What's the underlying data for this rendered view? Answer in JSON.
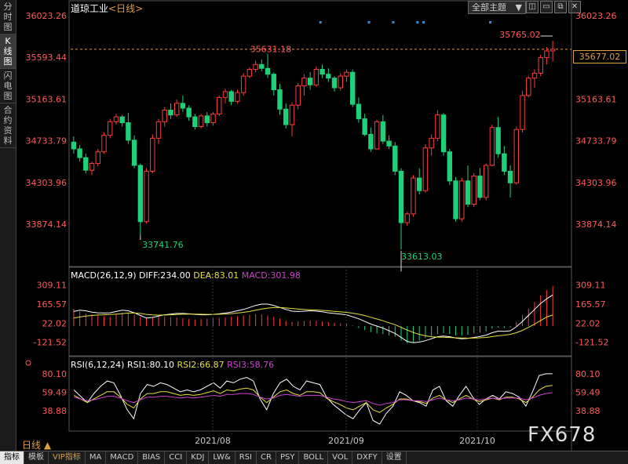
{
  "sidebar": {
    "items": [
      {
        "label": "分时图",
        "active": false
      },
      {
        "label": "K线图",
        "active": true
      },
      {
        "label": "闪电图",
        "active": false
      },
      {
        "label": "合约资料",
        "active": false
      }
    ]
  },
  "header": {
    "instrument": "道琼工业",
    "period": "<日线>",
    "main_indicator_select": "全部主题",
    "chevron": "▼"
  },
  "window_buttons": [
    "◫",
    "▭",
    "⧉",
    "✕"
  ],
  "current_price_label": "35677.02",
  "main_chart": {
    "y_ticks": [
      "36023.26",
      "35593.44",
      "35163.61",
      "34733.79",
      "34303.96",
      "33874.14"
    ],
    "annotations": {
      "high_left": "35631.18",
      "high_right": "35765.02",
      "low_left": "33741.76",
      "low_right": "33613.03"
    }
  },
  "macd": {
    "label_name": "MACD(26,12,9)",
    "diff": "DIFF:234.00",
    "dea": "DEA:83.01",
    "macd": "MACD:301.98",
    "y_ticks": [
      "309.11",
      "165.57",
      "22.02",
      "-121.52"
    ]
  },
  "rsi": {
    "label_name": "RSI(6,12,24)",
    "rsi1": "RSI1:80.10",
    "rsi2": "RSI2:66.87",
    "rsi3": "RSI3:58.76",
    "y_ticks": [
      "80.10",
      "59.49",
      "38.88"
    ]
  },
  "x_axis": {
    "labels": [
      "2021/08",
      "2021/09",
      "2021/10"
    ]
  },
  "period_label": "日线 ▲",
  "bottom_tabs": [
    {
      "label": "指标",
      "active": true,
      "vip": false
    },
    {
      "label": "模板",
      "active": false,
      "vip": false
    },
    {
      "label": "VIP指标",
      "active": false,
      "vip": true
    },
    {
      "label": "MA",
      "active": false,
      "vip": false
    },
    {
      "label": "MACD",
      "active": false,
      "vip": false
    },
    {
      "label": "BIAS",
      "active": false,
      "vip": false
    },
    {
      "label": "CCI",
      "active": false,
      "vip": false
    },
    {
      "label": "KDJ",
      "active": false,
      "vip": false
    },
    {
      "label": "LW&",
      "active": false,
      "vip": false
    },
    {
      "label": "RSI",
      "active": false,
      "vip": false
    },
    {
      "label": "CR",
      "active": false,
      "vip": false
    },
    {
      "label": "PSY",
      "active": false,
      "vip": false
    },
    {
      "label": "BOLL",
      "active": false,
      "vip": false
    },
    {
      "label": "VOL",
      "active": false,
      "vip": false
    },
    {
      "label": "DXFY",
      "active": false,
      "vip": false
    },
    {
      "label": "设置",
      "active": false,
      "vip": false
    }
  ],
  "watermark": "FX678",
  "colors": {
    "up": "#ff3b3b",
    "down": "#1fd07a",
    "macd_pos": "#ff3b3b",
    "macd_neg": "#1fd07a",
    "diff": "#ffffff",
    "dea": "#e8e040",
    "macd_text": "#d040d0",
    "price_line": "#e0a040"
  },
  "chart_data": {
    "type": "candlestick",
    "ylim": [
      33613.03,
      36023.26
    ],
    "candles": [
      [
        34720,
        34780,
        34600,
        34650
      ],
      [
        34650,
        34690,
        34520,
        34560
      ],
      [
        34560,
        34600,
        34400,
        34430
      ],
      [
        34430,
        34520,
        34380,
        34500
      ],
      [
        34500,
        34650,
        34470,
        34620
      ],
      [
        34620,
        34820,
        34600,
        34790
      ],
      [
        34790,
        34960,
        34760,
        34930
      ],
      [
        34930,
        35010,
        34900,
        34980
      ],
      [
        34980,
        35000,
        34880,
        34920
      ],
      [
        34920,
        35020,
        34700,
        34740
      ],
      [
        34740,
        34790,
        34450,
        34480
      ],
      [
        34480,
        34500,
        33760,
        33900
      ],
      [
        33900,
        34450,
        33880,
        34420
      ],
      [
        34420,
        34800,
        34400,
        34760
      ],
      [
        34760,
        34960,
        34700,
        34930
      ],
      [
        34930,
        35080,
        34880,
        35050
      ],
      [
        35050,
        35120,
        34960,
        35000
      ],
      [
        35000,
        35160,
        34980,
        35120
      ],
      [
        35120,
        35200,
        35030,
        35070
      ],
      [
        35070,
        35100,
        34940,
        34980
      ],
      [
        34980,
        35010,
        34850,
        34880
      ],
      [
        34880,
        35010,
        34860,
        34990
      ],
      [
        34990,
        35030,
        34880,
        34920
      ],
      [
        34920,
        35030,
        34890,
        35010
      ],
      [
        35010,
        35200,
        34990,
        35180
      ],
      [
        35180,
        35270,
        35120,
        35240
      ],
      [
        35240,
        35260,
        35100,
        35140
      ],
      [
        35140,
        35260,
        35120,
        35230
      ],
      [
        35230,
        35430,
        35200,
        35400
      ],
      [
        35400,
        35490,
        35380,
        35470
      ],
      [
        35470,
        35560,
        35440,
        35520
      ],
      [
        35520,
        35570,
        35450,
        35480
      ],
      [
        35480,
        35631,
        35380,
        35420
      ],
      [
        35420,
        35440,
        35200,
        35260
      ],
      [
        35260,
        35320,
        35000,
        35060
      ],
      [
        35060,
        35120,
        34860,
        34900
      ],
      [
        34900,
        35130,
        34780,
        35100
      ],
      [
        35100,
        35330,
        35060,
        35300
      ],
      [
        35300,
        35420,
        35200,
        35380
      ],
      [
        35380,
        35440,
        35260,
        35310
      ],
      [
        35310,
        35500,
        35290,
        35470
      ],
      [
        35470,
        35520,
        35380,
        35420
      ],
      [
        35420,
        35480,
        35340,
        35380
      ],
      [
        35380,
        35400,
        35240,
        35280
      ],
      [
        35280,
        35430,
        35250,
        35400
      ],
      [
        35400,
        35470,
        35340,
        35440
      ],
      [
        35440,
        35470,
        35080,
        35110
      ],
      [
        35110,
        35180,
        34920,
        34960
      ],
      [
        34960,
        35010,
        34780,
        34800
      ],
      [
        34800,
        34870,
        34620,
        34650
      ],
      [
        34650,
        34950,
        34640,
        34930
      ],
      [
        34930,
        35000,
        34700,
        34730
      ],
      [
        34730,
        34790,
        34650,
        34680
      ],
      [
        34680,
        34720,
        34380,
        34420
      ],
      [
        34420,
        34450,
        33613,
        33890
      ],
      [
        33890,
        34000,
        33860,
        33980
      ],
      [
        33980,
        34380,
        33950,
        34350
      ],
      [
        34350,
        34450,
        34180,
        34220
      ],
      [
        34220,
        34700,
        34200,
        34660
      ],
      [
        34660,
        34800,
        34580,
        34760
      ],
      [
        34760,
        35050,
        34730,
        35000
      ],
      [
        35000,
        35020,
        34580,
        34620
      ],
      [
        34620,
        34650,
        34280,
        34320
      ],
      [
        34320,
        34360,
        33900,
        33930
      ],
      [
        33930,
        34350,
        33900,
        34320
      ],
      [
        34320,
        34480,
        34050,
        34080
      ],
      [
        34080,
        34400,
        34050,
        34370
      ],
      [
        34370,
        34450,
        34120,
        34150
      ],
      [
        34150,
        34500,
        34120,
        34480
      ],
      [
        34480,
        34900,
        34470,
        34870
      ],
      [
        34870,
        34980,
        34560,
        34600
      ],
      [
        34600,
        34680,
        34380,
        34420
      ],
      [
        34420,
        34480,
        34150,
        34300
      ],
      [
        34300,
        34880,
        34280,
        34850
      ],
      [
        34850,
        35250,
        34820,
        35200
      ],
      [
        35200,
        35400,
        35180,
        35380
      ],
      [
        35380,
        35470,
        35280,
        35430
      ],
      [
        35430,
        35620,
        35400,
        35590
      ],
      [
        35590,
        35700,
        35520,
        35660
      ],
      [
        35660,
        35765,
        35550,
        35677
      ]
    ],
    "annotations": {
      "high_left": 35631.18,
      "high_right": 35765.02,
      "low_left": 33741.76,
      "low_right": 33613.03
    },
    "current_price": 35677.02,
    "macd": {
      "ylim": [
        -200,
        330
      ],
      "hist": [
        130,
        110,
        95,
        85,
        80,
        75,
        70,
        90,
        100,
        95,
        85,
        70,
        60,
        65,
        70,
        72,
        68,
        65,
        60,
        55,
        50,
        52,
        55,
        60,
        62,
        65,
        70,
        75,
        80,
        85,
        90,
        88,
        80,
        70,
        55,
        40,
        30,
        35,
        40,
        42,
        40,
        35,
        30,
        25,
        22,
        20,
        5,
        -15,
        -30,
        -45,
        -55,
        -60,
        -70,
        -80,
        -110,
        -130,
        -125,
        -110,
        -90,
        -75,
        -60,
        -55,
        -60,
        -70,
        -72,
        -65,
        -55,
        -50,
        -40,
        -20,
        -10,
        -15,
        -10,
        30,
        80,
        130,
        180,
        230,
        270,
        301.98
      ],
      "diff": [
        110,
        120,
        115,
        105,
        100,
        98,
        100,
        110,
        120,
        115,
        100,
        80,
        60,
        65,
        75,
        85,
        90,
        95,
        95,
        92,
        88,
        85,
        85,
        88,
        92,
        98,
        105,
        115,
        125,
        140,
        155,
        165,
        165,
        155,
        140,
        125,
        112,
        110,
        112,
        115,
        112,
        108,
        100,
        95,
        90,
        85,
        70,
        55,
        35,
        15,
        0,
        -15,
        -35,
        -55,
        -85,
        -115,
        -125,
        -120,
        -110,
        -95,
        -80,
        -75,
        -80,
        -90,
        -95,
        -92,
        -85,
        -78,
        -68,
        -50,
        -38,
        -40,
        -35,
        -5,
        35,
        80,
        125,
        170,
        205,
        234
      ],
      "dea": [
        60,
        68,
        75,
        80,
        83,
        85,
        87,
        90,
        94,
        98,
        98,
        95,
        88,
        84,
        82,
        83,
        85,
        87,
        89,
        90,
        90,
        89,
        88,
        88,
        89,
        91,
        94,
        98,
        103,
        110,
        119,
        128,
        135,
        139,
        139,
        136,
        132,
        128,
        125,
        123,
        121,
        118,
        115,
        111,
        107,
        103,
        97,
        89,
        79,
        66,
        53,
        40,
        25,
        10,
        -10,
        -30,
        -48,
        -62,
        -73,
        -80,
        -83,
        -84,
        -86,
        -88,
        -90,
        -91,
        -90,
        -88,
        -85,
        -79,
        -73,
        -68,
        -62,
        -50,
        -32,
        -10,
        15,
        42,
        68,
        83.01
      ]
    },
    "rsi": {
      "ylim": [
        18,
        86
      ],
      "rsi1": [
        62,
        55,
        48,
        58,
        66,
        72,
        70,
        56,
        40,
        30,
        58,
        68,
        66,
        70,
        68,
        64,
        60,
        62,
        60,
        62,
        66,
        70,
        64,
        72,
        70,
        74,
        76,
        72,
        52,
        40,
        58,
        70,
        74,
        66,
        62,
        72,
        70,
        68,
        54,
        46,
        40,
        34,
        30,
        40,
        48,
        28,
        24,
        36,
        44,
        60,
        56,
        50,
        48,
        44,
        62,
        66,
        50,
        44,
        56,
        66,
        54,
        46,
        52,
        56,
        52,
        60,
        58,
        54,
        44,
        60,
        78,
        80,
        80
      ],
      "rsi2": [
        56,
        52,
        48,
        52,
        56,
        60,
        60,
        54,
        46,
        42,
        52,
        58,
        58,
        60,
        60,
        58,
        56,
        57,
        56,
        57,
        59,
        61,
        58,
        62,
        61,
        63,
        64,
        62,
        54,
        48,
        54,
        60,
        62,
        58,
        56,
        60,
        60,
        59,
        53,
        49,
        46,
        42,
        40,
        44,
        48,
        40,
        37,
        42,
        46,
        52,
        52,
        50,
        49,
        47,
        53,
        56,
        51,
        48,
        52,
        56,
        52,
        49,
        51,
        53,
        51,
        54,
        54,
        52,
        48,
        54,
        62,
        66,
        67
      ],
      "rsi3": [
        54,
        52,
        50,
        51,
        53,
        55,
        55,
        53,
        50,
        48,
        51,
        54,
        54,
        55,
        55,
        54,
        53,
        54,
        53,
        54,
        55,
        56,
        55,
        57,
        57,
        58,
        58,
        57,
        54,
        52,
        53,
        56,
        57,
        56,
        55,
        56,
        56,
        56,
        54,
        52,
        51,
        49,
        48,
        49,
        50,
        47,
        45,
        47,
        48,
        51,
        51,
        50,
        50,
        49,
        51,
        53,
        51,
        50,
        51,
        53,
        52,
        51,
        52,
        53,
        52,
        53,
        53,
        53,
        51,
        53,
        56,
        58,
        59
      ]
    }
  }
}
